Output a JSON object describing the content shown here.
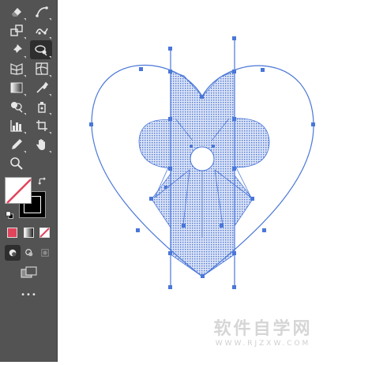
{
  "toolbar": {
    "tools": [
      "eraser-tool",
      "curvature-tool",
      "free-transform-tool",
      "puppet-warp-tool",
      "pin-tool",
      "lasso-chat-tool",
      "perspective-grid-tool",
      "mesh-tool",
      "gradient-tool",
      "eyedropper-tool",
      "shape-builder-tool",
      "symbol-sprayer-tool",
      "column-graph-tool",
      "artboard-tool",
      "pencil-tool",
      "hand-tool",
      "zoom-tool"
    ],
    "more_label": "•••"
  },
  "colors": {
    "toolbar_bg": "#535353",
    "selection": "#4a77d8",
    "fill_swatch_color": "#e2445c",
    "stroke": "#000000",
    "fill": "#ffffff"
  },
  "watermark": {
    "main": "软件自学网",
    "sub": "WWW.RJZXW.COM"
  }
}
